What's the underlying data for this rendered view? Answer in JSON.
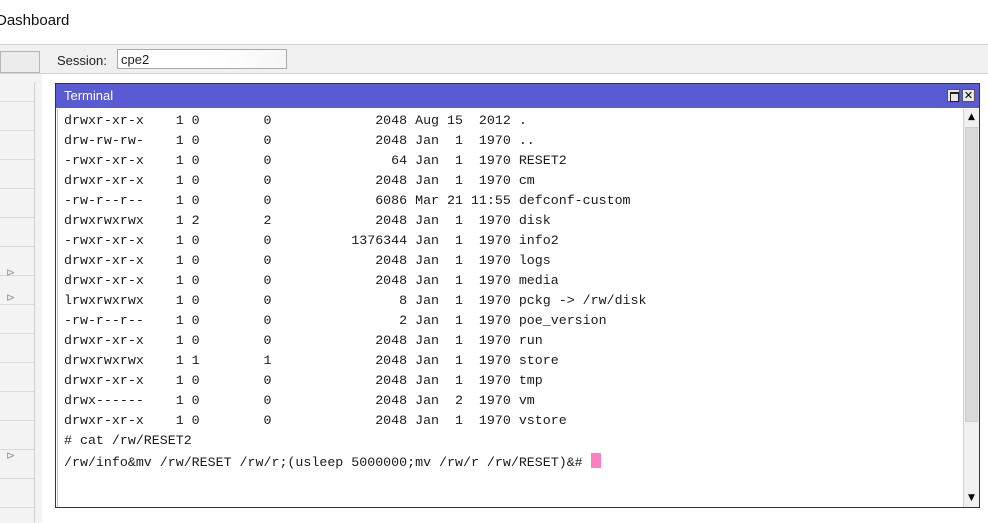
{
  "app": {
    "title": "Dashboard"
  },
  "session": {
    "label": "Session:",
    "value": "cpe2"
  },
  "terminal": {
    "title": "Terminal",
    "lines": [
      "drwxr-xr-x    1 0        0             2048 Aug 15  2012 .",
      "drw-rw-rw-    1 0        0             2048 Jan  1  1970 ..",
      "-rwxr-xr-x    1 0        0               64 Jan  1  1970 RESET2",
      "drwxr-xr-x    1 0        0             2048 Jan  1  1970 cm",
      "-rw-r--r--    1 0        0             6086 Mar 21 11:55 defconf-custom",
      "drwxrwxrwx    1 2        2             2048 Jan  1  1970 disk",
      "-rwxr-xr-x    1 0        0          1376344 Jan  1  1970 info2",
      "drwxr-xr-x    1 0        0             2048 Jan  1  1970 logs",
      "drwxr-xr-x    1 0        0             2048 Jan  1  1970 media",
      "lrwxrwxrwx    1 0        0                8 Jan  1  1970 pckg -> /rw/disk",
      "-rw-r--r--    1 0        0                2 Jan  1  1970 poe_version",
      "drwxr-xr-x    1 0        0             2048 Jan  1  1970 run",
      "drwxrwxrwx    1 1        1             2048 Jan  1  1970 store",
      "drwxr-xr-x    1 0        0             2048 Jan  1  1970 tmp",
      "drwx------    1 0        0             2048 Jan  2  1970 vm",
      "drwxr-xr-x    1 0        0             2048 Jan  1  1970 vstore",
      "# cat /rw/RESET2",
      "/rw/info&mv /rw/RESET /rw/r;(usleep 5000000;mv /rw/r /rw/RESET)&# "
    ],
    "cursor_color": "#ff80c0",
    "titlebar_color": "#5a5ad2"
  },
  "icons": {
    "maximize": "maximize-icon",
    "close": "close-icon",
    "scroll_up": "triangle-up-icon",
    "scroll_down": "triangle-down-icon"
  }
}
